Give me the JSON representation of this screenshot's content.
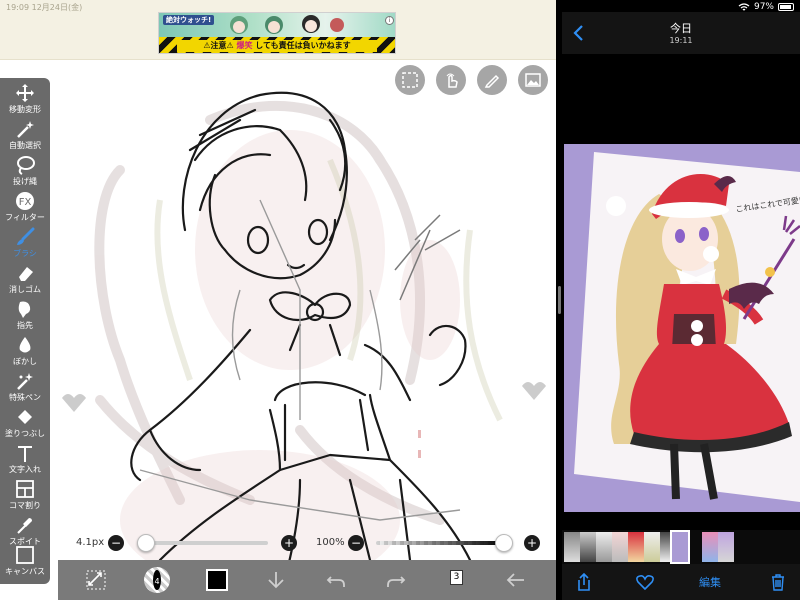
{
  "left_app": {
    "status_text": "19:09  12月24日(金)",
    "ad": {
      "logo_text": "絶対ウォッチ!",
      "info_icon": "info-icon",
      "warning_prefix": "⚠注意⚠",
      "warning_highlight": "爆笑",
      "warning_suffix": "しても責任は負いかねます",
      "banner_text": "⚠注意⚠ 爆笑しても責任は負いかねます"
    },
    "top_tools": [
      "selection-icon",
      "touch-icon",
      "pen-lock-icon",
      "image-icon"
    ],
    "toolbar": [
      {
        "label": "移動変形",
        "icon": "move-icon"
      },
      {
        "label": "自動選択",
        "icon": "magic-wand-icon"
      },
      {
        "label": "投げ縄",
        "icon": "lasso-icon"
      },
      {
        "label": "フィルター",
        "icon": "fx-icon"
      },
      {
        "label": "ブラシ",
        "icon": "brush-icon",
        "active": true
      },
      {
        "label": "消しゴム",
        "icon": "eraser-icon"
      },
      {
        "label": "指先",
        "icon": "finger-icon"
      },
      {
        "label": "ぼかし",
        "icon": "blur-icon"
      },
      {
        "label": "特殊ペン",
        "icon": "special-pen-icon"
      },
      {
        "label": "塗りつぶし",
        "icon": "fill-icon"
      },
      {
        "label": "文字入れ",
        "icon": "text-icon"
      },
      {
        "label": "コマ割り",
        "icon": "frame-icon"
      },
      {
        "label": "スポイト",
        "icon": "eyedropper-icon"
      },
      {
        "label": "キャンバス",
        "icon": "canvas-icon"
      }
    ],
    "brush_size": {
      "label": "4.1px",
      "value_fraction": 0.06
    },
    "opacity": {
      "label": "100%",
      "value_fraction": 1.0
    },
    "minus": "−",
    "plus": "+",
    "bottom_bar": {
      "layer_count": "3",
      "brush_number": "4",
      "color": "#000000"
    },
    "colors": {
      "accent": "#3f8fe3",
      "toolbar_bg": "#6a6a6a",
      "bottom_bar_bg": "#7a7a7a"
    }
  },
  "right_app": {
    "status": {
      "battery": "97%",
      "wifi_icon": "wifi-icon"
    },
    "header": {
      "title": "今日",
      "subtitle": "19:11"
    },
    "photo_text": "これはこれで可愛い",
    "toolbar": {
      "edit_label": "編集"
    },
    "colors": {
      "accent": "#2f8ff5",
      "photo_bg": "#a99ad4"
    }
  }
}
